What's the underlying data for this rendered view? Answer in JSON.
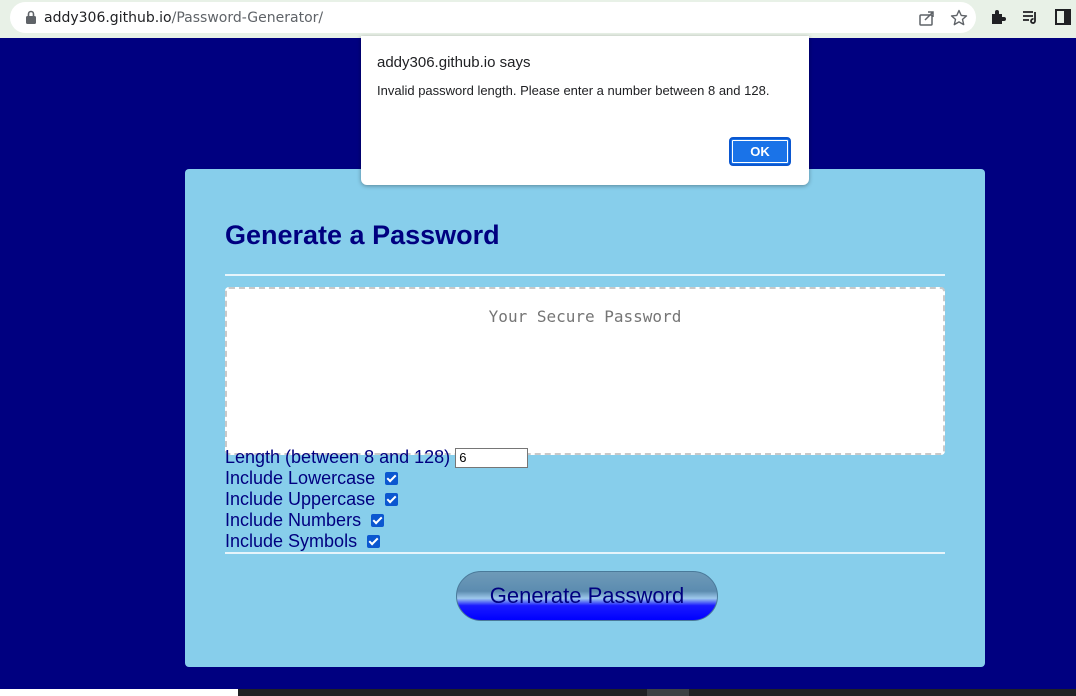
{
  "browser": {
    "url_host": "addy306.github.io",
    "url_path": "/Password-Generator/",
    "icons": [
      "lock-icon",
      "share-icon",
      "star-icon",
      "extensions-icon",
      "reading-list-icon",
      "side-panel-icon"
    ]
  },
  "card": {
    "title": "Generate a Password",
    "password_placeholder": "Your Secure Password",
    "length_label": "Length (between 8 and 128)",
    "length_value": "6",
    "options": {
      "lowercase": {
        "label": "Include Lowercase",
        "checked": true
      },
      "uppercase": {
        "label": "Include Uppercase",
        "checked": true
      },
      "numbers": {
        "label": "Include Numbers",
        "checked": true
      },
      "symbols": {
        "label": "Include Symbols",
        "checked": true
      }
    },
    "generate_label": "Generate Password"
  },
  "dialog": {
    "title": "addy306.github.io says",
    "message": "Invalid password length. Please enter a number between 8 and 128.",
    "ok_label": "OK"
  },
  "colors": {
    "page_bg": "#000080",
    "card_bg": "#87ceeb",
    "text": "#000080",
    "ok_button": "#1a73e8"
  }
}
